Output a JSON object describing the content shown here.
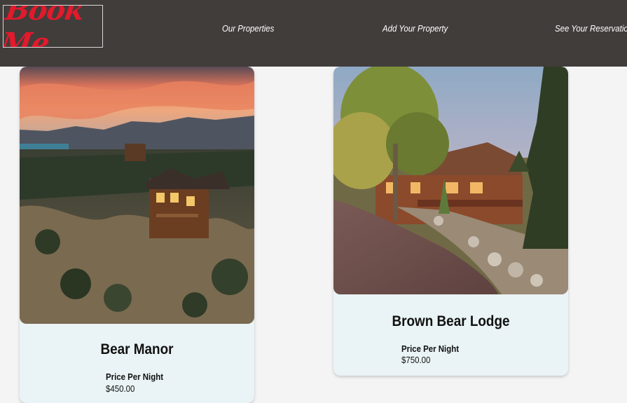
{
  "header": {
    "logo_text": "Book Me",
    "nav": [
      "Our Properties",
      "Add Your Property",
      "See Your Reservations"
    ]
  },
  "properties": [
    {
      "name": "Bear Manor",
      "price_label": "Price Per Night",
      "price": "$450.00",
      "image": "aerial view of mountain lodge at sunset"
    },
    {
      "name": "Brown Bear Lodge",
      "price_label": "Price Per Night",
      "price": "$750.00",
      "image": "log cabin with stone driveway and pine trees"
    }
  ],
  "colors": {
    "header_bg": "#413d3b",
    "logo_red": "#e3192c",
    "page_bg": "#f4f4f4",
    "card_bg": "#eaf3f5"
  }
}
